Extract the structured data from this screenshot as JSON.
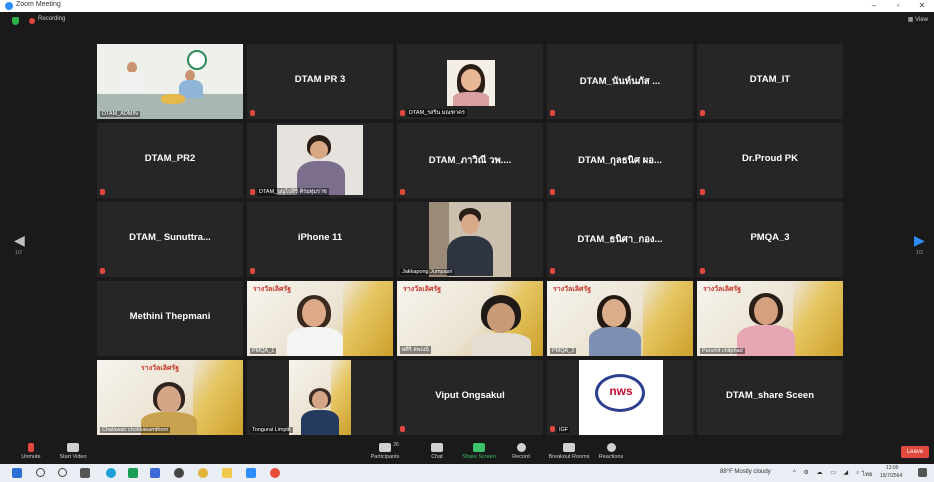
{
  "window": {
    "title": "Zoom Meeting",
    "minimize": "–",
    "maximize": "▫",
    "close": "✕"
  },
  "status": {
    "recording": "Recording",
    "view": "View"
  },
  "tiles": [
    {
      "label": "DTAM_ADMIN"
    },
    {
      "name": "DTAM PR 3"
    },
    {
      "label": "DTAM_รสริน มณฑาคร"
    },
    {
      "name": "DTAM_นันท์นภัส ..."
    },
    {
      "name": "DTAM_IT"
    },
    {
      "name": "DTAM_PR2"
    },
    {
      "label": "DTAM_บุญไปสิริ คิรมทุมราช"
    },
    {
      "name": "DTAM_ภาวิณี วพ...."
    },
    {
      "name": "DTAM_กุลธนิศ ผอ..."
    },
    {
      "name": "Dr.Proud PK"
    },
    {
      "name": "DTAM_ Sunuttra..."
    },
    {
      "name": "iPhone 11"
    },
    {
      "label": "Jakkapong Jumpasri"
    },
    {
      "name": "DTAM_ธนิศา_กอง..."
    },
    {
      "name": "PMQA_3"
    },
    {
      "name": "Methini Thepmani"
    },
    {
      "label": "PMQA_1"
    },
    {
      "label": "ผศิริ ลพณนิ"
    },
    {
      "label": "PMQA_2"
    },
    {
      "label": "Panchit chitphad"
    },
    {
      "label": "Chalawan chotikakamthorn"
    },
    {
      "label": "Tongurai Limpiti"
    },
    {
      "name": "Viput Ongsakul"
    },
    {
      "label": "IGF",
      "logo": "nws"
    },
    {
      "name": "DTAM_share Sceen"
    }
  ],
  "slide_title": "รางวัลเลิศรัฐ",
  "nav": {
    "left_page": "1/2",
    "right_page": "1/2"
  },
  "toolbar": {
    "unmute": "Unmute",
    "start_video": "Start Video",
    "participants": "Participants",
    "participants_count": "26",
    "chat": "Chat",
    "share_screen": "Share Screen",
    "record": "Record",
    "breakout_rooms": "Breakout Rooms",
    "reactions": "Reactions",
    "leave": "Leave"
  },
  "taskbar": {
    "weather": "88°F  Mostly cloudy",
    "lang": "ไทย",
    "time": "13:05",
    "date": "15/7/2564"
  },
  "colors": {
    "accent_green": "#3cc36a",
    "recording_red": "#e0483e",
    "zoom_blue": "#2d8cff",
    "active_speaker": "#8fd14f"
  }
}
